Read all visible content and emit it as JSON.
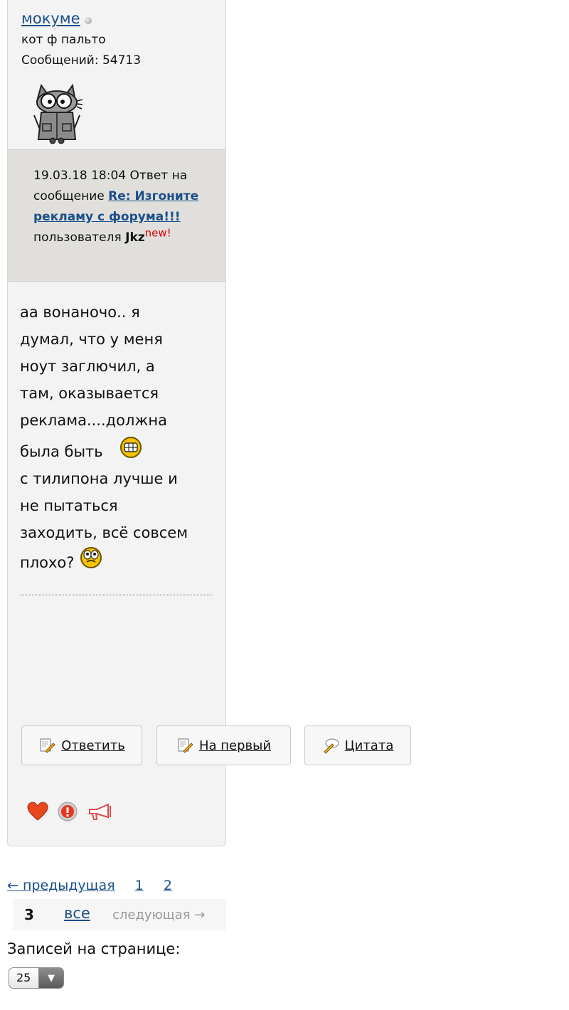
{
  "author": {
    "username": "мокуме",
    "title": "кот ф пальто",
    "posts_label": "Сообщений: 54713"
  },
  "meta": {
    "datetime": "19.03.18 18:04",
    "reply_prefix": "Ответ на сообщение",
    "reply_link": "Re: Изгоните рекламу с форума!!!",
    "by_label": "пользователя",
    "reply_user": "Jkz",
    "new_badge": "new!"
  },
  "message": {
    "line1": "аа вонаночо.. я",
    "line2": "думал, что у меня",
    "line3": "ноут заглючил, а",
    "line4": "там, оказывается",
    "line5": "реклама....должна",
    "line6": "была быть",
    "line7": "с тилипона лучше и",
    "line8": "не пытаться",
    "line9": "заходить, всё совсем",
    "line10": "плохо?"
  },
  "buttons": {
    "reply": "Ответить",
    "to_first": "На первый",
    "quote": "Цитата"
  },
  "pagination": {
    "prev": "← предыдущая",
    "pages": [
      "1",
      "2"
    ],
    "current": "3",
    "all": "все",
    "next": "следующая →"
  },
  "per_page": {
    "label": "Записей на странице:",
    "value": "25"
  }
}
